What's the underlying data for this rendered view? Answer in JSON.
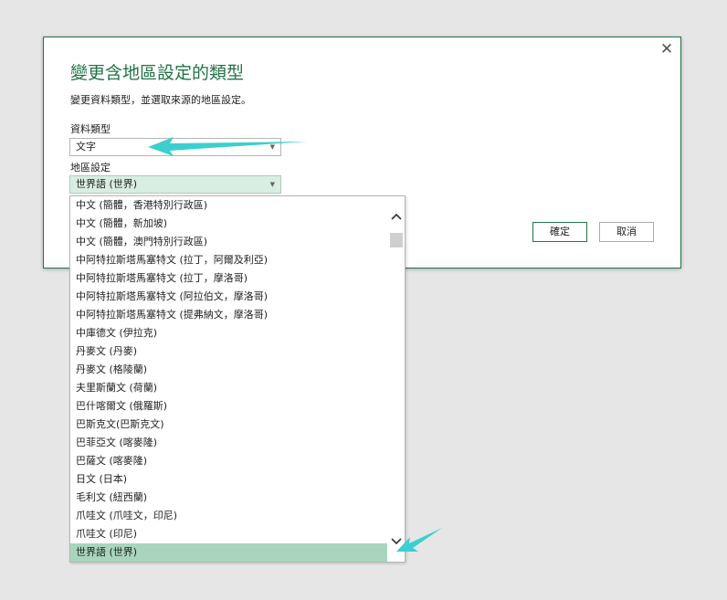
{
  "dialog": {
    "title": "變更含地區設定的類型",
    "subtitle": "變更資料類型，並選取來源的地區設定。",
    "data_type_label": "資料類型",
    "data_type_value": "文字",
    "locale_label": "地區設定",
    "locale_value": "世界語 (世界)",
    "ok_label": "確定",
    "cancel_label": "取消",
    "close_glyph": "✕"
  },
  "locale_list": {
    "items": [
      "中文 (簡體，香港特別行政區)",
      "中文 (簡體，新加坡)",
      "中文 (簡體，澳門特別行政區)",
      "中阿特拉斯塔馬塞特文 (拉丁，阿爾及利亞)",
      "中阿特拉斯塔馬塞特文 (拉丁，摩洛哥)",
      "中阿特拉斯塔馬塞特文 (阿拉伯文，摩洛哥)",
      "中阿特拉斯塔馬塞特文 (提弗納文，摩洛哥)",
      "中庫德文 (伊拉克)",
      "丹麥文 (丹麥)",
      "丹麥文 (格陵蘭)",
      "夫里斯蘭文 (荷蘭)",
      "巴什喀爾文 (俄羅斯)",
      "巴斯克文(巴斯克文)",
      "巴菲亞文 (喀麥隆)",
      "巴薩文 (喀麥隆)",
      "日文 (日本)",
      "毛利文 (紐西蘭)",
      "爪哇文 (爪哇文，印尼)",
      "爪哇文 (印尼)",
      "世界語 (世界)"
    ],
    "selected_index": 19
  },
  "icons": {
    "caret": "down-triangle-icon",
    "scroll_up": "chevron-up-icon",
    "scroll_down": "chevron-down-icon",
    "close": "close-icon"
  },
  "colors": {
    "accent": "#217346",
    "selected_bg": "#a9d5bd",
    "annotation_arrow": "#3ccfcf"
  }
}
